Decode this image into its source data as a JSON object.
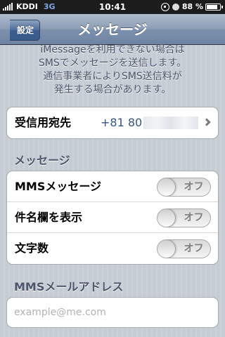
{
  "status_bar": {
    "carrier": "KDDI",
    "network": "3G",
    "time": "10:41",
    "battery_percent": "88 %",
    "battery_level": 0.88
  },
  "nav": {
    "back_label": "設定",
    "title": "メッセージ"
  },
  "top_footer": {
    "lines": [
      "iMessageを利用できない場合は",
      "SMSでメッセージを送信します。",
      "通信事業者によりSMS送信料が",
      "発生する場合があります。"
    ]
  },
  "receive_at": {
    "label": "受信用宛先",
    "value": "+81 80"
  },
  "messages_section": {
    "header": "メッセージ",
    "rows": [
      {
        "label": "MMSメッセージ",
        "toggle": "オフ"
      },
      {
        "label": "件名欄を表示",
        "toggle": "オフ"
      },
      {
        "label": "文字数",
        "toggle": "オフ"
      }
    ]
  },
  "mms_email": {
    "header": "MMSメールアドレス",
    "placeholder": "example@me.com"
  },
  "colors": {
    "nav_bar": "#7d91ad",
    "background": "#c5ccd4",
    "value_text": "#385487",
    "section_text": "#4c566c"
  }
}
